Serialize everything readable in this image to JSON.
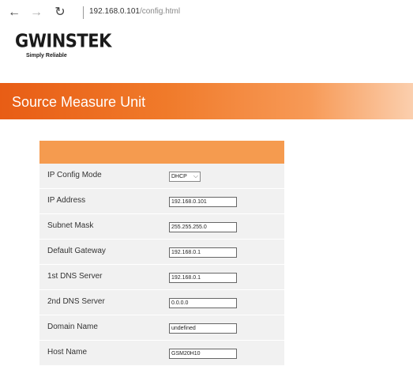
{
  "browser": {
    "back": "←",
    "forward": "→",
    "reload": "↻",
    "url_host": "192.168.0.101",
    "url_path": "/config.html"
  },
  "logo": {
    "name": "GWINSTEK",
    "tagline": "Simply Reliable"
  },
  "banner": {
    "title": "Source Measure Unit"
  },
  "config": {
    "rows": [
      {
        "label": "IP Config Mode",
        "value": "DHCP",
        "kind": "select"
      },
      {
        "label": "IP Address",
        "value": "192.168.0.101",
        "kind": "input"
      },
      {
        "label": "Subnet Mask",
        "value": "255.255.255.0",
        "kind": "input"
      },
      {
        "label": "Default Gateway",
        "value": "192.168.0.1",
        "kind": "input"
      },
      {
        "label": "1st DNS Server",
        "value": "192.168.0.1",
        "kind": "input"
      },
      {
        "label": "2nd DNS Server",
        "value": "0.0.0.0",
        "kind": "input"
      },
      {
        "label": "Domain Name",
        "value": "undefined",
        "kind": "input"
      },
      {
        "label": "Host Name",
        "value": "GSM20H10",
        "kind": "input"
      }
    ]
  },
  "colors": {
    "banner_orange": "#e85d15",
    "panel_header": "#f59b4f",
    "panel_bg": "#f1f1f1"
  }
}
